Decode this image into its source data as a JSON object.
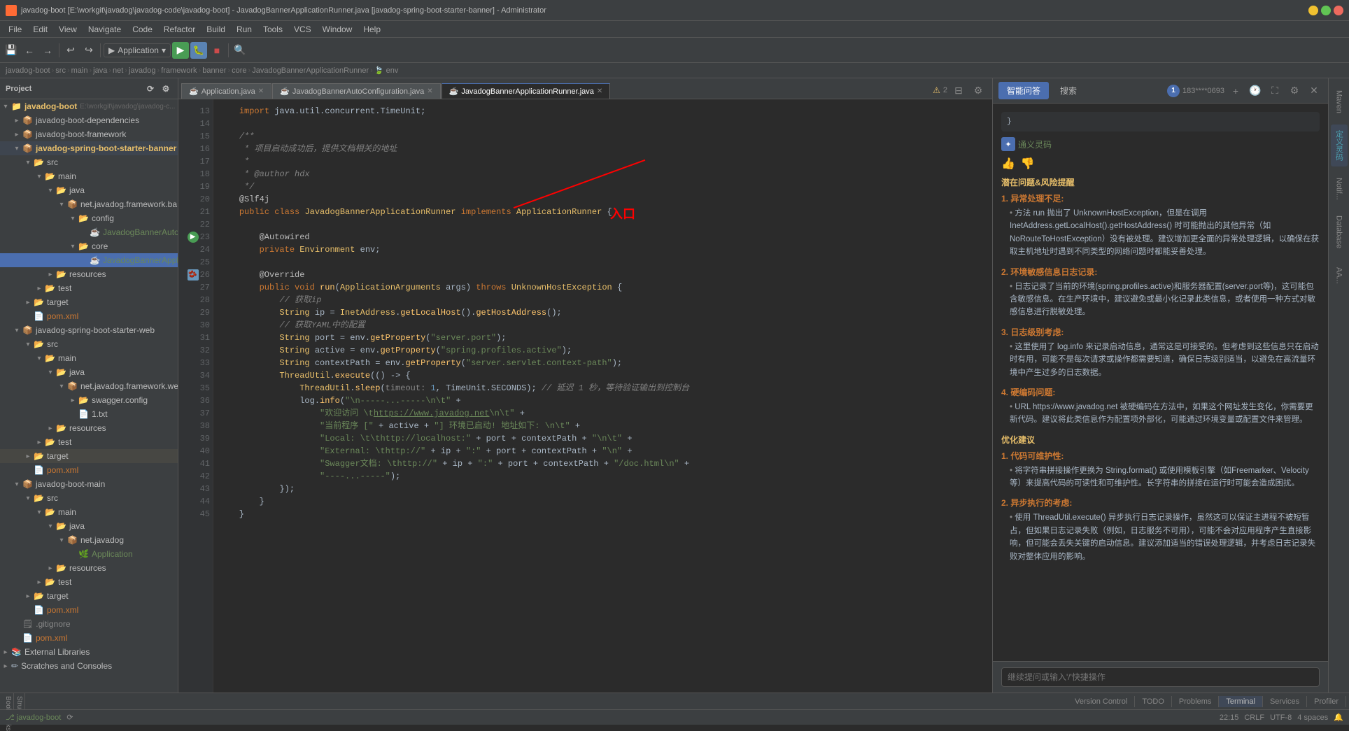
{
  "titleBar": {
    "title": "javadog-boot [E:\\workgit\\javadog\\javadog-code\\javadog-boot] - JavadogBannerApplicationRunner.java [javadog-spring-boot-starter-banner] - Administrator",
    "appName": "IntelliJ IDEA"
  },
  "menuBar": {
    "items": [
      "File",
      "Edit",
      "View",
      "Navigate",
      "Code",
      "Refactor",
      "Build",
      "Run",
      "Tools",
      "VCS",
      "Window",
      "Help"
    ]
  },
  "toolbar": {
    "runConfig": "Application",
    "runLabel": "▶",
    "debugLabel": "🐛"
  },
  "breadcrumb": {
    "items": [
      "javadog-boot",
      "src",
      "main",
      "java",
      "net",
      "javadog",
      "framework",
      "banner",
      "core",
      "JavadogBannerApplicationRunner",
      "env"
    ]
  },
  "sidebar": {
    "title": "Project",
    "items": [
      {
        "level": 0,
        "type": "project",
        "expanded": true,
        "label": "javadog-boot",
        "suffix": "E:\\workgit\\javadog\\javadog-c..."
      },
      {
        "level": 1,
        "type": "folder",
        "expanded": false,
        "label": "javadog-boot-dependencies"
      },
      {
        "level": 1,
        "type": "folder",
        "expanded": false,
        "label": "javadog-boot-framework"
      },
      {
        "level": 1,
        "type": "folder",
        "expanded": true,
        "label": "javadog-spring-boot-starter-banner",
        "highlight": true
      },
      {
        "level": 2,
        "type": "folder",
        "expanded": true,
        "label": "src"
      },
      {
        "level": 3,
        "type": "folder",
        "expanded": true,
        "label": "main"
      },
      {
        "level": 4,
        "type": "folder",
        "expanded": true,
        "label": "java"
      },
      {
        "level": 5,
        "type": "folder",
        "expanded": true,
        "label": "net.javadog.framework.ba..."
      },
      {
        "level": 6,
        "type": "folder",
        "expanded": true,
        "label": "config"
      },
      {
        "level": 7,
        "type": "java",
        "expanded": false,
        "label": "JavadogBannerAutoC..."
      },
      {
        "level": 6,
        "type": "folder",
        "expanded": true,
        "label": "core"
      },
      {
        "level": 7,
        "type": "java",
        "expanded": false,
        "label": "JavadogBannerAppl...",
        "active": true
      },
      {
        "level": 4,
        "type": "folder",
        "expanded": false,
        "label": "resources"
      },
      {
        "level": 3,
        "type": "folder",
        "expanded": false,
        "label": "test"
      },
      {
        "level": 2,
        "type": "folder",
        "expanded": false,
        "label": "target"
      },
      {
        "level": 2,
        "type": "xml",
        "expanded": false,
        "label": "pom.xml"
      },
      {
        "level": 1,
        "type": "folder",
        "expanded": true,
        "label": "javadog-spring-boot-starter-web"
      },
      {
        "level": 2,
        "type": "folder",
        "expanded": true,
        "label": "src"
      },
      {
        "level": 3,
        "type": "folder",
        "expanded": true,
        "label": "main"
      },
      {
        "level": 4,
        "type": "folder",
        "expanded": true,
        "label": "java"
      },
      {
        "level": 5,
        "type": "folder",
        "expanded": true,
        "label": "net.javadog.framework.we..."
      },
      {
        "level": 6,
        "type": "folder",
        "expanded": false,
        "label": "swagger.config"
      },
      {
        "level": 6,
        "type": "txt",
        "expanded": false,
        "label": "1.txt"
      },
      {
        "level": 4,
        "type": "folder",
        "expanded": false,
        "label": "resources"
      },
      {
        "level": 3,
        "type": "folder",
        "expanded": false,
        "label": "test"
      },
      {
        "level": 2,
        "type": "folder",
        "expanded": false,
        "label": "target",
        "highlight2": true
      },
      {
        "level": 2,
        "type": "xml",
        "expanded": false,
        "label": "pom.xml"
      },
      {
        "level": 1,
        "type": "folder",
        "expanded": true,
        "label": "javadog-boot-main"
      },
      {
        "level": 2,
        "type": "folder",
        "expanded": true,
        "label": "src"
      },
      {
        "level": 3,
        "type": "folder",
        "expanded": true,
        "label": "main"
      },
      {
        "level": 4,
        "type": "folder",
        "expanded": true,
        "label": "java"
      },
      {
        "level": 5,
        "type": "folder",
        "expanded": true,
        "label": "net.javadog"
      },
      {
        "level": 6,
        "type": "java",
        "expanded": false,
        "label": "Application"
      },
      {
        "level": 4,
        "type": "folder",
        "expanded": false,
        "label": "resources"
      },
      {
        "level": 3,
        "type": "folder",
        "expanded": false,
        "label": "test"
      },
      {
        "level": 2,
        "type": "folder",
        "expanded": false,
        "label": "target"
      },
      {
        "level": 2,
        "type": "xml",
        "expanded": false,
        "label": "pom.xml"
      },
      {
        "level": 1,
        "type": "git",
        "expanded": false,
        "label": ".gitignore"
      },
      {
        "level": 1,
        "type": "xml",
        "expanded": false,
        "label": "pom.xml"
      },
      {
        "level": 0,
        "type": "folder",
        "expanded": false,
        "label": "External Libraries"
      },
      {
        "level": 0,
        "type": "folder",
        "expanded": false,
        "label": "Scratches and Consoles"
      }
    ],
    "bottomItems": [
      "Version Control",
      "TODO",
      "Problems",
      "Terminal",
      "Services",
      "Profiler"
    ]
  },
  "editorTabs": [
    {
      "label": "Application.java",
      "active": false
    },
    {
      "label": "JavadogBannerAutoConfiguration.java",
      "active": false
    },
    {
      "label": "JavadogBannerApplicationRunner.java",
      "active": true
    }
  ],
  "codeLines": [
    {
      "num": 13,
      "code": "    import java.util.concurrent.TimeUnit;"
    },
    {
      "num": 14,
      "code": ""
    },
    {
      "num": 15,
      "code": "    /**"
    },
    {
      "num": 16,
      "code": "     * 项目启动成功后，提供文档相关的地址"
    },
    {
      "num": 17,
      "code": "     *"
    },
    {
      "num": 18,
      "code": "     * @author hdx"
    },
    {
      "num": 19,
      "code": "     */"
    },
    {
      "num": 20,
      "code": "    @Slf4j"
    },
    {
      "num": 21,
      "code": "    public class JavadogBannerApplicationRunner implements ApplicationRunner {"
    },
    {
      "num": 22,
      "code": ""
    },
    {
      "num": 23,
      "code": "        @Autowired"
    },
    {
      "num": 24,
      "code": "        private Environment env;"
    },
    {
      "num": 25,
      "code": ""
    },
    {
      "num": 26,
      "code": "        @Override"
    },
    {
      "num": 27,
      "code": "        public void run(ApplicationArguments args) throws UnknownHostException {"
    },
    {
      "num": 28,
      "code": "            // 获取ip"
    },
    {
      "num": 29,
      "code": "            String ip = InetAddress.getLocalHost().getHostAddress();"
    },
    {
      "num": 30,
      "code": "            // 获取YAML中的配置"
    },
    {
      "num": 31,
      "code": "            String port = env.getProperty(\"server.port\");"
    },
    {
      "num": 32,
      "code": "            String active = env.getProperty(\"spring.profiles.active\");"
    },
    {
      "num": 33,
      "code": "            String contextPath = env.getProperty(\"server.servlet.context-path\");"
    },
    {
      "num": 34,
      "code": "            ThreadUtil.execute(() -> {"
    },
    {
      "num": 35,
      "code": "                ThreadUtil.sleep(timeout: 1, TimeUnit.SECONDS); // 延迟 1 秒，等待验证输出到控制台"
    },
    {
      "num": 36,
      "code": "                log.info(\"\\n-----...-----\\n\\t\" +"
    },
    {
      "num": 37,
      "code": "                    \"欢迎访问 \\thttps://www.javadog.net\\n\\t\" +"
    },
    {
      "num": 38,
      "code": "                    \"当前程序 [\" + active + \"] 环境已启动! 地址如下: \\n\\t\" +"
    },
    {
      "num": 39,
      "code": "                    \"Local: \\t\\thttp://localhost:\" + port + contextPath + \"\\n\\t\" +"
    },
    {
      "num": 40,
      "code": "                    \"External: \\thttp://\" + ip + \":\" + port + contextPath + \"\\n\" +"
    },
    {
      "num": 41,
      "code": "                    \"Swagger文档: \\thttp://\" + ip + \":\" + port + contextPath + \"/doc.html\\n\" +"
    },
    {
      "num": 42,
      "code": "                    \"----...-----\");"
    },
    {
      "num": 43,
      "code": "            });"
    },
    {
      "num": 44,
      "code": "        }"
    },
    {
      "num": 45,
      "code": "    }"
    }
  ],
  "aiPanel": {
    "title": "通义灵码",
    "tabs": [
      "智能问答",
      "搜索"
    ],
    "userInfo": "183****0693",
    "codeSnippet": "    }",
    "badgeLabel": "通义灵码",
    "riskTitle": "潜在问题&风险提醒",
    "sections": [
      {
        "num": "1.",
        "title": "异常处理不足:",
        "bullets": [
          "方法 run 抛出了 UnknownHostException，但是在调用 InetAddress.getLocalHost().getHostAddress() 时可能抛出的其他异常（如 NoRouteToHostException）没有被处理。建议增加更全面的异常处理逻辑，以确保在获取主机地址时遇到不同类型的网络问题时都能妥善处理。"
        ]
      },
      {
        "num": "2.",
        "title": "环境敏感信息日志记录:",
        "bullets": [
          "日志记录了当前的环境(spring.profiles.active)和服务器配置(server.port等)，这可能包含敏感信息。在生产环境中，建议避免或最小化记录此类信息，或者使用一种方式对敏感信息进行脱敏处理。"
        ]
      },
      {
        "num": "3.",
        "title": "日志级别考虑:",
        "bullets": [
          "这里使用了 log.info 来记录启动信息，通常这是可接受的。但考虑到这些信息只在启动时有用，可能不是每次请求或操作都需要知道，确保日志级别适当，以避免在高流量环境中产生过多的日志数据。"
        ]
      },
      {
        "num": "4.",
        "title": "硬编码问题:",
        "bullets": [
          "URL https://www.javadog.net 被硬编码在方法中，如果这个网址发生变化，你需要更新代码。建议将此类信息作为配置项外部化，可能通过环境变量或配置文件来管理。"
        ]
      }
    ],
    "optimizeTitle": "优化建议",
    "optimizeSections": [
      {
        "num": "1.",
        "title": "代码可维护性:",
        "bullets": [
          "将字符串拼接操作更换为 String.format() 或使用模板引擎（如Freemarker、Velocity等）来提高代码的可读性和可维护性。长字符串的拼接在运行时可能会造成困扰。"
        ]
      },
      {
        "num": "2.",
        "title": "异步执行的考虑:",
        "bullets": [
          "使用 ThreadUtil.execute() 异步执行日志记录操作，虽然这可以保证主进程不被短暂占，但如果日志记录失败（例如，日志服务不可用），可能不会对应用程序产生直接影响，但可能会丢失关键的启动信息。建议添加适当的错误处理逻辑，并考虑日志记录失败对整体应用的影响。"
        ]
      }
    ],
    "inputPlaceholder": "继续提问或输入'/'快捷操作",
    "annotationText": "入口"
  },
  "statusBar": {
    "branch": "javadog-boot",
    "encoding": "UTF-8",
    "lineEnding": "CRLF",
    "position": "22:15",
    "spaces": "4 spaces"
  },
  "farRight": {
    "buttons": [
      "Maven",
      "定义灵码",
      "Notifications",
      "Database",
      "AA Assistant"
    ]
  }
}
